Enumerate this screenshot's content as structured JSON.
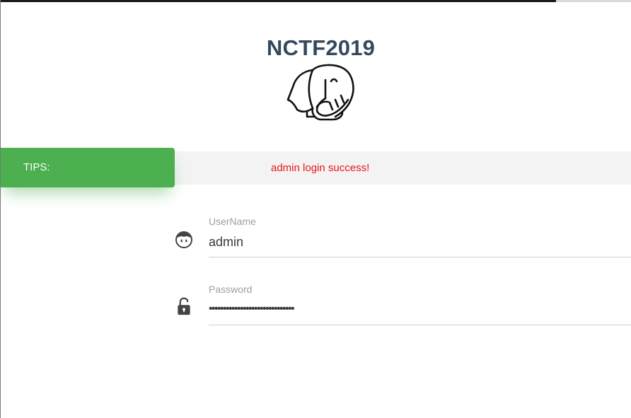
{
  "page": {
    "progress": 0.88
  },
  "header": {
    "title": "NCTF2019",
    "logo_icon": "elephant-icon"
  },
  "tips": {
    "label": "TIPS:",
    "message": "admin login success!",
    "badge_color": "#4caf50",
    "message_color": "#e8141c"
  },
  "form": {
    "username": {
      "label": "UserName",
      "value": "admin",
      "icon": "user-face-icon"
    },
    "password": {
      "label": "Password",
      "value": "••••••••••••••••••••••••••••••",
      "icon": "unlocked-padlock-icon"
    }
  }
}
